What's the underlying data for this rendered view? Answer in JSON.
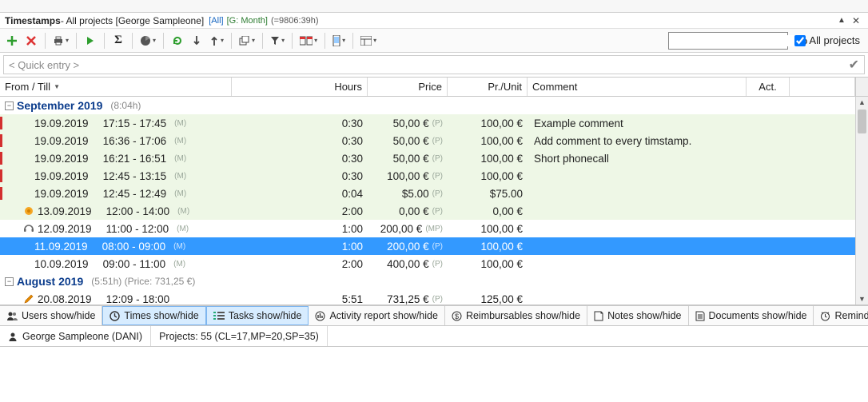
{
  "titlebar": {
    "title_main": "Timestamps",
    "title_rest": " - All projects [George Sampleone]",
    "filter_all": "[All]",
    "filter_month": "[G: Month]",
    "total": "(=9806:39h)"
  },
  "toolbar": {
    "search_placeholder": "",
    "all_projects_label": "All projects",
    "all_projects_checked": true
  },
  "quickentry": {
    "placeholder": "< Quick entry >"
  },
  "columns": {
    "from_till": "From / Till",
    "hours": "Hours",
    "price": "Price",
    "pr_unit": "Pr./Unit",
    "comment": "Comment",
    "act": "Act."
  },
  "months": [
    {
      "label": "September 2019",
      "meta": "(8:04h)",
      "expander": "−",
      "rows": [
        {
          "red": true,
          "icon": "",
          "date": "19.09.2019",
          "time": "17:15 - 17:45",
          "tag": "(M)",
          "hours": "0:30",
          "price": "50,00 €",
          "ptag": "(P)",
          "pu": "100,00 €",
          "comment": "Example comment",
          "green": true
        },
        {
          "red": true,
          "icon": "",
          "date": "19.09.2019",
          "time": "16:36 - 17:06",
          "tag": "(M)",
          "hours": "0:30",
          "price": "50,00 €",
          "ptag": "(P)",
          "pu": "100,00 €",
          "comment": "Add comment to every timstamp.",
          "green": true
        },
        {
          "red": true,
          "icon": "",
          "date": "19.09.2019",
          "time": "16:21 - 16:51",
          "tag": "(M)",
          "hours": "0:30",
          "price": "50,00 €",
          "ptag": "(P)",
          "pu": "100,00 €",
          "comment": "Short phonecall",
          "green": true
        },
        {
          "red": true,
          "icon": "",
          "date": "19.09.2019",
          "time": "12:45 - 13:15",
          "tag": "(M)",
          "hours": "0:30",
          "price": "100,00 €",
          "ptag": "(P)",
          "pu": "100,00 €",
          "comment": "",
          "green": true
        },
        {
          "red": true,
          "icon": "",
          "date": "19.09.2019",
          "time": "12:45 - 12:49",
          "tag": "(M)",
          "hours": "0:04",
          "price": "$5.00",
          "ptag": "(P)",
          "pu": "$75.00",
          "comment": "",
          "green": true
        },
        {
          "red": false,
          "icon": "star",
          "date": "13.09.2019",
          "time": "12:00 - 14:00",
          "tag": "(M)",
          "hours": "2:00",
          "price": "0,00 €",
          "ptag": "(P)",
          "pu": "0,00 €",
          "comment": "",
          "green": true
        },
        {
          "red": false,
          "icon": "headset",
          "date": "12.09.2019",
          "time": "11:00 - 12:00",
          "tag": "(M)",
          "hours": "1:00",
          "price": "200,00 €",
          "ptag": "(MP)",
          "pu": "100,00 €",
          "comment": "",
          "green": false
        },
        {
          "red": false,
          "icon": "",
          "date": "11.09.2019",
          "time": "08:00 - 09:00",
          "tag": "(M)",
          "hours": "1:00",
          "price": "200,00 €",
          "ptag": "(P)",
          "pu": "100,00 €",
          "comment": "",
          "green": false,
          "selected": true
        },
        {
          "red": false,
          "icon": "",
          "date": "10.09.2019",
          "time": "09:00 - 11:00",
          "tag": "(M)",
          "hours": "2:00",
          "price": "400,00 €",
          "ptag": "(P)",
          "pu": "100,00 €",
          "comment": "",
          "green": false
        }
      ]
    },
    {
      "label": "August 2019",
      "meta": "(5:51h) (Price: 731,25 €)",
      "expander": "−",
      "rows": [
        {
          "red": false,
          "icon": "pencil",
          "date": "20.08.2019",
          "time": "12:09 - 18:00",
          "tag": "",
          "hours": "5:51",
          "price": "731,25 €",
          "ptag": "(P)",
          "pu": "125,00 €",
          "comment": "",
          "green": false
        }
      ]
    }
  ],
  "bottombar": {
    "users": "Users show/hide",
    "times": "Times show/hide",
    "tasks": "Tasks show/hide",
    "activity": "Activity report show/hide",
    "reimb": "Reimbursables show/hide",
    "notes": "Notes show/hide",
    "docs": "Documents show/hide",
    "remind": "Reminders sho"
  },
  "statusbar": {
    "user": "George Sampleone (DANI)",
    "projects": "Projects: 55 (CL=17,MP=20,SP=35)"
  }
}
